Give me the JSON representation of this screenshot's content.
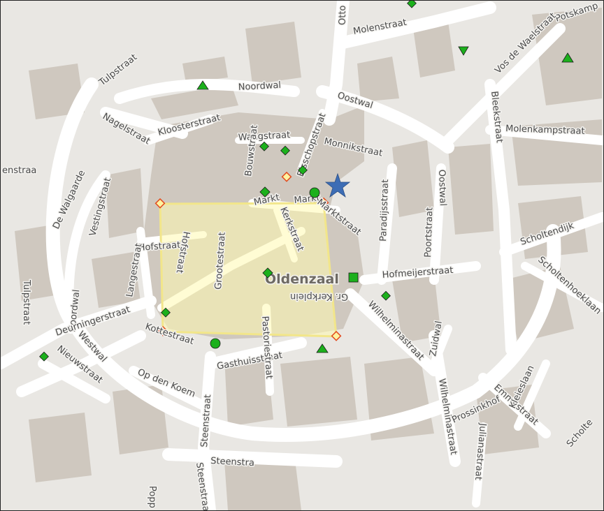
{
  "map": {
    "town": "Oldenzaal",
    "streets": {
      "otto": "Otto",
      "molenstraat": "Molenstraat",
      "potskamp": "Potskamp",
      "vos_de_waelstraat": "Vos de Waelstraat",
      "noordwal": "Noordwal",
      "tulpstraat_top": "Tulpstraat",
      "nagelstraat": "Nagelstraat",
      "kloosterstraat": "Kloosterstraat",
      "oostwal_top": "Oostwal",
      "bleekstraat": "Bleekstraat",
      "molenkampstraat": "Molenkampstraat",
      "waagstraat": "Waagstraat",
      "bouwstraat": "Bouwstraat",
      "bisschopstraat": "Bisschopstraat",
      "monnikstraat": "Monnikstraat",
      "paradijsstraat": "Paradijsstraat",
      "oostwal_right": "Oostwal",
      "poortstraat": "Poortstraat",
      "scholtendijk": "Scholtendijk",
      "scholtenhoeklaan": "Scholtenhoeklaan",
      "markt_1": "Markt",
      "markt_2": "Markt",
      "marktstraat": "Marktstraat",
      "kerkstraat": "Kerkstraat",
      "de_walgaarde": "De Walgaarde",
      "vestingstraat": "Vestingstraat",
      "hofstraat": "Hofstraat",
      "hofstraat_vertical": "Hofstraat",
      "grootestraat": "Grootestraat",
      "langestraat": "Langestraat",
      "groot_kerkplein": "Gr. Kerkplein",
      "hofmeijerstraat": "Hofmeijerstraat",
      "noordwal_left": "Noordwal",
      "tulpstraat_left": "Tulpstraat",
      "deurningerstraat": "Deurningerstraat",
      "koelestraat": "Kottestraat",
      "wilhelminastraat_1": "Wilhelminastraat",
      "zuidwal": "Zuidwal",
      "wilhelminastraat_2": "Wilhelminastraat",
      "westwal": "Westwal",
      "nieuwstraat": "Nieuwstraat",
      "gasthuisstraat": "Gasthuisstraat",
      "pastoriestraat": "Pastoriestraat",
      "op_den_koem": "Op den Koem",
      "steenstraat_vertical": "Steenstraat",
      "steenstraat_bottom": "Steenstra",
      "steenstraat_lower": "Steenstraat",
      "prossinkhof": "Prossinkhof",
      "emmastraat": "Emmastraat",
      "kleieslaan": "Kleieslaan",
      "julianastraat": "Julianastraat",
      "scholte": "Scholte",
      "popp": "Popp",
      "enstraa": "enstraa"
    },
    "colors": {
      "background": "#e9e7e3",
      "building": "#cfc8bf",
      "road": "#ffffff",
      "selection_fill": "#fffab0",
      "selection_stroke": "#f2e68a",
      "marker_green": "#1cb01c",
      "marker_star": "#3d6db5",
      "marker_vertex": "#f28c1e"
    },
    "markers": [
      {
        "type": "diamond",
        "name": "diamond-top"
      },
      {
        "type": "triangle-down",
        "name": "triangle-down-north"
      },
      {
        "type": "triangle",
        "name": "triangle-northeast"
      },
      {
        "type": "triangle",
        "name": "triangle-noordwal"
      },
      {
        "type": "diamond",
        "name": "diamond-waagstraat-1"
      },
      {
        "type": "diamond",
        "name": "diamond-waagstraat-2"
      },
      {
        "type": "diamond",
        "name": "diamond-bisschopstraat"
      },
      {
        "type": "diamond",
        "name": "diamond-markt"
      },
      {
        "type": "circle",
        "name": "circle-markt"
      },
      {
        "type": "star",
        "name": "star-location"
      },
      {
        "type": "diamond",
        "name": "diamond-center"
      },
      {
        "type": "square",
        "name": "square-kerkplein"
      },
      {
        "type": "diamond",
        "name": "diamond-wilhelminastraat"
      },
      {
        "type": "diamond",
        "name": "diamond-langestraat"
      },
      {
        "type": "circle",
        "name": "circle-gasthuisstraat"
      },
      {
        "type": "triangle",
        "name": "triangle-gasthuisstraat"
      },
      {
        "type": "diamond",
        "name": "diamond-nieuwstraat"
      }
    ]
  }
}
